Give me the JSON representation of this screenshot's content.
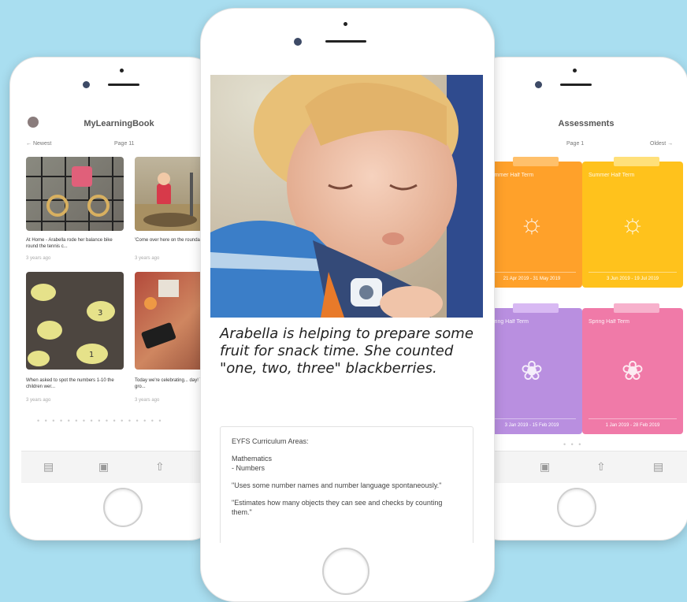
{
  "left_phone": {
    "app_title": "MyLearningBook",
    "nav_left": "← Newest",
    "nav_center": "Page 11",
    "items": [
      {
        "caption": "At Home - Arabella rode her balance bike round the tennis c...",
        "time": "3 years ago"
      },
      {
        "caption": "'Come over here on the roundabout, it's fun!'",
        "time": "3 years ago"
      },
      {
        "caption": "When asked to spot the numbers 1-10 the children wer...",
        "time": "3 years ago"
      },
      {
        "caption": "Today we're celebrating... day! The children gro...",
        "time": "3 years ago"
      }
    ],
    "dots": "• • • • • • • • • • • • • • • • •"
  },
  "center_phone": {
    "observation_text": "Arabella is helping to prepare some fruit for snack time. She counted \"one, two, three\" blackberries.",
    "curriculum_heading": "EYFS Curriculum Areas:",
    "area": "Mathematics",
    "subarea": "- Numbers",
    "statement_1": "\"Uses some number names and number language spontaneously.\"",
    "statement_2": "\"Estimates how many objects they can see and checks by counting them.\""
  },
  "right_phone": {
    "app_title": "Assessments",
    "nav_center": "Page 1",
    "nav_right": "Oldest →",
    "cards": [
      {
        "title": "Summer Half Term",
        "dates": "21 Apr 2019 - 31 May 2019",
        "color": "#ffa12a",
        "clip": "#ffc06b",
        "icon": "sun-icon"
      },
      {
        "title": "Summer Half Term",
        "dates": "3 Jun 2019 - 19 Jul 2019",
        "color": "#ffc21c",
        "clip": "#ffe07a",
        "icon": "sun-icon"
      },
      {
        "title": "Spring Half Term",
        "dates": "3 Jan 2019 - 15 Feb 2019",
        "color": "#b98fe0",
        "clip": "#d8b9f3",
        "icon": "flower-icon"
      },
      {
        "title": "Spring Half Term",
        "dates": "1 Jan 2019 - 28 Feb 2019",
        "color": "#f07aa8",
        "clip": "#f7b1cc",
        "icon": "flower-icon"
      }
    ],
    "dots": "• • •"
  }
}
